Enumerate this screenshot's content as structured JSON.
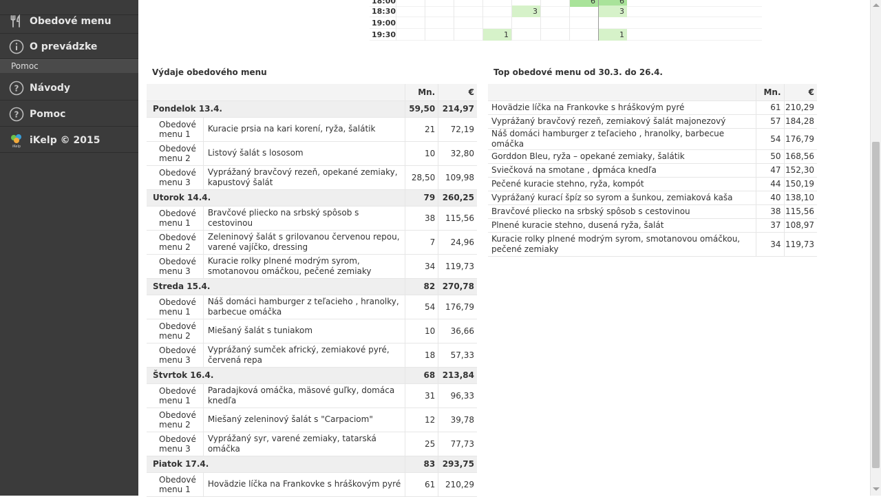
{
  "sidebar": {
    "items": [
      {
        "label": "Obedové menu",
        "icon": "fork-knife-icon"
      },
      {
        "label": "O prevádzke",
        "icon": "info-icon"
      },
      {
        "label": "Návody",
        "icon": "help-icon"
      },
      {
        "label": "Pomoc",
        "icon": "help-icon"
      },
      {
        "label": "iKelp © 2015",
        "icon": "ikelp-logo-icon"
      }
    ],
    "section_label": "Pomoc",
    "logo_text": "iKelp"
  },
  "heatmap": {
    "rows": [
      {
        "time": "18:00",
        "cells": [
          "",
          "",
          "",
          "",
          "",
          "",
          "6",
          "6"
        ]
      },
      {
        "time": "18:30",
        "cells": [
          "",
          "",
          "",
          "",
          "3",
          "",
          "",
          "3"
        ]
      },
      {
        "time": "19:00",
        "cells": [
          "",
          "",
          "",
          "",
          "",
          "",
          "",
          ""
        ]
      },
      {
        "time": "19:30",
        "cells": [
          "",
          "",
          "",
          "1",
          "",
          "",
          "",
          "1"
        ]
      }
    ]
  },
  "left": {
    "title": "Výdaje obedového menu",
    "headers": {
      "mn": "Mn.",
      "eur": "€"
    },
    "days": [
      {
        "name": "Pondelok 13.4.",
        "mn": "59,50",
        "eur": "214,97",
        "rows": [
          {
            "type": "Obedové menu 1",
            "dish": "Kuracie prsia na kari korení, ryža, šalátik",
            "mn": "21",
            "eur": "72,19"
          },
          {
            "type": "Obedové menu 2",
            "dish": "Listový šalát s lososom",
            "mn": "10",
            "eur": "32,80"
          },
          {
            "type": "Obedové menu 3",
            "dish": "Vyprážaný bravčový rezeň, opekané zemiaky, kapustový šalát",
            "mn": "28,50",
            "eur": "109,98"
          }
        ]
      },
      {
        "name": "Utorok 14.4.",
        "mn": "79",
        "eur": "260,25",
        "rows": [
          {
            "type": "Obedové menu 1",
            "dish": "Bravčové pliecko na srbský spôsob s cestovinou",
            "mn": "38",
            "eur": "115,56"
          },
          {
            "type": "Obedové menu 2",
            "dish": "Zeleninový šalát s grilovanou červenou repou, varené vajíčko, dressing",
            "mn": "7",
            "eur": "24,96"
          },
          {
            "type": "Obedové menu 3",
            "dish": "Kuracie rolky plnené modrým syrom, smotanovou omáčkou, pečené zemiaky",
            "mn": "34",
            "eur": "119,73"
          }
        ]
      },
      {
        "name": "Streda 15.4.",
        "mn": "82",
        "eur": "270,78",
        "rows": [
          {
            "type": "Obedové menu 1",
            "dish": "Náš domáci hamburger z teľacieho , hranolky, barbecue omáčka",
            "mn": "54",
            "eur": "176,79"
          },
          {
            "type": "Obedové menu 2",
            "dish": "Miešaný šalát s tuniakom",
            "mn": "10",
            "eur": "36,66"
          },
          {
            "type": "Obedové menu 3",
            "dish": "Vyprážaný sumček africký, zemiakové pyré, červená repa",
            "mn": "18",
            "eur": "57,33"
          }
        ]
      },
      {
        "name": "Štvrtok 16.4.",
        "mn": "68",
        "eur": "213,84",
        "rows": [
          {
            "type": "Obedové menu 1",
            "dish": "Paradajková omáčka, mäsové guľky, domáca knedľa",
            "mn": "31",
            "eur": "96,33"
          },
          {
            "type": "Obedové menu 2",
            "dish": "Miešaný zeleninový šalát s \"Carpaciom\"",
            "mn": "12",
            "eur": "39,78"
          },
          {
            "type": "Obedové menu 3",
            "dish": "Vyprážaný syr, varené zemiaky, tatarská omáčka",
            "mn": "25",
            "eur": "77,73"
          }
        ]
      },
      {
        "name": "Piatok 17.4.",
        "mn": "83",
        "eur": "293,75",
        "rows": [
          {
            "type": "Obedové menu 1",
            "dish": "Hovädzie líčka na Frankovke s hráškovým pyré",
            "mn": "61",
            "eur": "210,29"
          }
        ]
      }
    ]
  },
  "right": {
    "title": "Top obedové menu od 30.3. do 26.4.",
    "headers": {
      "mn": "Mn.",
      "eur": "€"
    },
    "rows": [
      {
        "name": "Hovädzie líčka na Frankovke s hráškovým pyré",
        "mn": "61",
        "eur": "210,29"
      },
      {
        "name": "Vyprážaný bravčový rezeň, zemiakový šalát majonezový",
        "mn": "57",
        "eur": "184,28"
      },
      {
        "name": "Náš domáci hamburger z teľacieho , hranolky, barbecue omáčka",
        "mn": "54",
        "eur": "176,79"
      },
      {
        "name": "Gorddon Bleu, ryža – opekané zemiaky, šalátik",
        "mn": "50",
        "eur": "168,56"
      },
      {
        "name": "Sviečková na smotane , domáca knedľa",
        "mn": "47",
        "eur": "152,30"
      },
      {
        "name": "Pečené kuracie stehno, ryža, kompót",
        "mn": "44",
        "eur": "150,19"
      },
      {
        "name": "Vyprážaný kurací špíz so syrom a šunkou, zemiaková kaša",
        "mn": "40",
        "eur": "138,10"
      },
      {
        "name": "Bravčové pliecko na srbský spôsob s cestovinou",
        "mn": "38",
        "eur": "115,56"
      },
      {
        "name": "Plnené kuracie stehno, dusená ryža, šalát",
        "mn": "37",
        "eur": "108,97"
      },
      {
        "name": "Kuracie rolky plnené modrým syrom, smotanovou omáčkou, pečené zemiaky",
        "mn": "34",
        "eur": "119,73"
      }
    ]
  },
  "colors": {
    "sidebar_bg": "#3b3b3b",
    "heat_green": "#d6f2c9",
    "heat_green_strong": "#a9e39a"
  }
}
